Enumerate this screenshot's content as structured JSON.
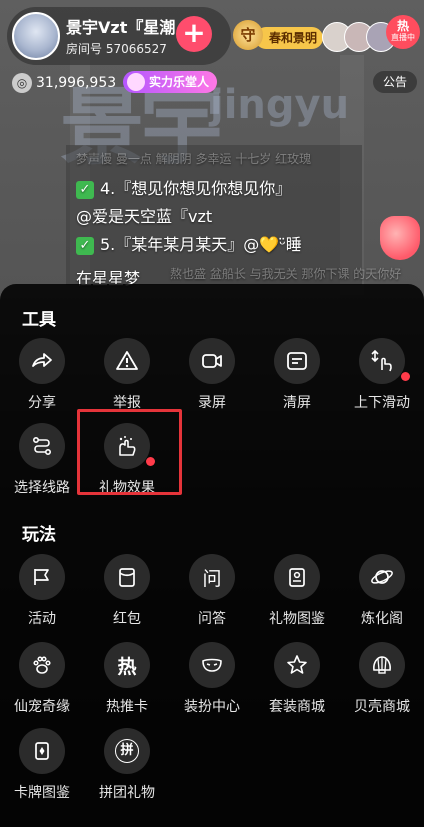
{
  "header": {
    "host_name": "景宇Vzt『星潮",
    "room_id": "房间号 57066527",
    "tag_label": "春和景明",
    "live_status": "直播中",
    "live_status_char": "热",
    "shou_char": "守"
  },
  "stats": {
    "coins": "31,996,953",
    "strength_tag": "实力乐堂人",
    "notice_label": "公告"
  },
  "background": {
    "logo_text": "景宇",
    "logo_sub": "jingyu"
  },
  "chat": {
    "line1_gray": "梦声慢 曼一点 解阴阴 多幸运 十七岁 红玫瑰",
    "line2": "4.『想见你想见你想见你』",
    "line3": "@爱是天空蓝『vzt",
    "line4": "5.『某年某月某天』@💛ᵕ̈睡",
    "line5": "在星星梦",
    "line6_gray": "熬也盛 盆船长 与我无关 那你下课 的天你好"
  },
  "tools": {
    "title": "工具",
    "items": [
      {
        "label": "分享",
        "icon": "share-icon"
      },
      {
        "label": "举报",
        "icon": "report-icon"
      },
      {
        "label": "录屏",
        "icon": "record-icon"
      },
      {
        "label": "清屏",
        "icon": "clear-screen-icon"
      },
      {
        "label": "上下滑动",
        "icon": "swipe-icon"
      },
      {
        "label": "选择线路",
        "icon": "route-icon"
      },
      {
        "label": "礼物效果",
        "icon": "gift-effect-icon"
      }
    ]
  },
  "play": {
    "title": "玩法",
    "items": [
      {
        "label": "活动",
        "icon": "flag-icon"
      },
      {
        "label": "红包",
        "icon": "red-packet-icon"
      },
      {
        "label": "问答",
        "icon": "qa-icon",
        "glyph": "问"
      },
      {
        "label": "礼物图鉴",
        "icon": "gift-book-icon"
      },
      {
        "label": "炼化阁",
        "icon": "planet-icon"
      },
      {
        "label": "仙宠奇缘",
        "icon": "paw-icon"
      },
      {
        "label": "热推卡",
        "icon": "hot-icon",
        "glyph": "热"
      },
      {
        "label": "装扮中心",
        "icon": "mask-icon"
      },
      {
        "label": "套装商城",
        "icon": "star-icon"
      },
      {
        "label": "贝壳商城",
        "icon": "shell-icon"
      },
      {
        "label": "卡牌图鉴",
        "icon": "card-icon"
      },
      {
        "label": "拼团礼物",
        "icon": "group-gift-icon",
        "glyph": "拼"
      }
    ]
  },
  "colors": {
    "accent_red": "#e5343a",
    "plus_button": "#ff4d6d",
    "sheet_bg": "#000000"
  }
}
